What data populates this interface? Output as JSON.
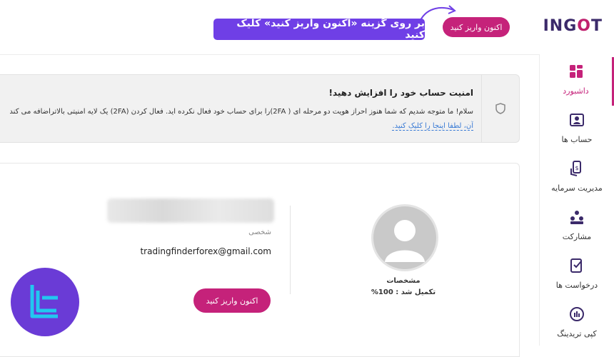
{
  "header": {
    "logo": {
      "part1": "ING",
      "part2": "O",
      "part3": "T"
    },
    "deposit_button": "اکنون واریز کنید",
    "callout": "بر روی گزینه «اکنون واریز کنید» کلیک کنید"
  },
  "sidebar": {
    "items": [
      {
        "label": "داشبورد",
        "icon": "dashboard-icon",
        "active": true
      },
      {
        "label": "حساب ها",
        "icon": "accounts-icon"
      },
      {
        "label": "مدیریت سرمایه",
        "icon": "money-management-icon"
      },
      {
        "label": "مشارکت",
        "icon": "partnership-icon"
      },
      {
        "label": "درخواست ها",
        "icon": "requests-icon"
      },
      {
        "label": "کپی تریدینگ",
        "icon": "copy-trading-icon"
      }
    ]
  },
  "alert": {
    "title": "امنیت حساب خود را افزایش دهید!",
    "body_line1": "سلام! ما متوجه شدیم که شما هنوز احراز هویت دو مرحله ای ( 2FA)را برای حساب خود فعال نکرده اید. فعال کردن (2FA) یک لایه امنیتی بالاتراضافه می کند",
    "body_line2": "آن، لطفا اینجا را کلیک کنید."
  },
  "profile": {
    "title": "مشخصات",
    "completion": "تکمیل شد : 100%",
    "role": "شخصی",
    "email": "tradingfinderforex@gmail.com",
    "deposit_button": "اکنون واریز کنید"
  },
  "colors": {
    "accent": "#c5227a",
    "callout": "#6f3fe6",
    "brand_badge": "#6a3bd6",
    "brand_mark": "#22c7f0"
  }
}
